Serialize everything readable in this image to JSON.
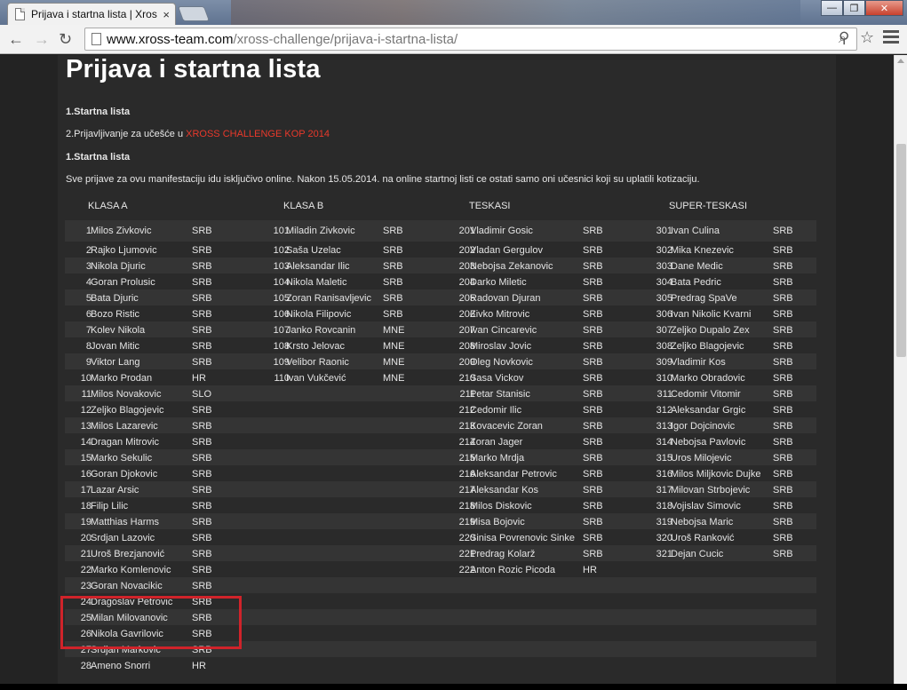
{
  "browser": {
    "tab_title": "Prijava i startna lista | Xros",
    "tab_close": "×",
    "url_host": "www.xross-team.com",
    "url_path": "/xross-challenge/prijava-i-startna-lista/"
  },
  "page": {
    "title": "Prijava i startna lista",
    "link1": "1.Startna lista",
    "link2_prefix": "2.Prijavljivanje za učešće u ",
    "link2_highlight": "XROSS CHALLENGE KOP 2014",
    "section_heading": "1.Startna lista",
    "notice": "Sve prijave za ovu manifestaciju idu isključivo online.   Nakon 15.05.2014. na online startnoj listi ce ostati samo oni učesnici koji su uplatili kotizaciju."
  },
  "columns": [
    "KLASA A",
    "KLASA B",
    "TESKASI",
    "SUPER-TESKASI"
  ],
  "rows": [
    [
      [
        "1",
        "Milos Zivkovic",
        "SRB"
      ],
      [
        "101",
        "Miladin Zivkovic",
        "SRB"
      ],
      [
        "201",
        "Vladimir Gosic",
        "SRB"
      ],
      [
        "301",
        "Ivan Culina",
        "SRB"
      ]
    ],
    [
      [
        "2",
        "Rajko Ljumovic",
        "SRB"
      ],
      [
        "102",
        "Saša Uzelac",
        "SRB"
      ],
      [
        "202",
        "Vladan Gergulov",
        "SRB"
      ],
      [
        "302",
        "Mika Knezevic",
        "SRB"
      ]
    ],
    [
      [
        "3",
        "Nikola Djuric",
        "SRB"
      ],
      [
        "103",
        "Aleksandar Ilic",
        "SRB"
      ],
      [
        "203",
        "Nebojsa Zekanovic",
        "SRB"
      ],
      [
        "303",
        "Dane Medic",
        "SRB"
      ]
    ],
    [
      [
        "4",
        "Goran Prolusic",
        "SRB"
      ],
      [
        "104",
        "Nikola Maletic",
        "SRB"
      ],
      [
        "204",
        "Darko Miletic",
        "SRB"
      ],
      [
        "304",
        "Bata Pedric",
        "SRB"
      ]
    ],
    [
      [
        "5",
        "Bata Djuric",
        "SRB"
      ],
      [
        "105",
        "Zoran Ranisavljevic",
        "SRB"
      ],
      [
        "205",
        "Radovan Djuran",
        "SRB"
      ],
      [
        "305",
        "Predrag SpaVe",
        "SRB"
      ]
    ],
    [
      [
        "6",
        "Bozo Ristic",
        "SRB"
      ],
      [
        "106",
        "Nikola Filipovic",
        "SRB"
      ],
      [
        "206",
        "Zivko Mitrovic",
        "SRB"
      ],
      [
        "306",
        "Ivan Nikolic Kvarni",
        "SRB"
      ]
    ],
    [
      [
        "7",
        "Kolev Nikola",
        "SRB"
      ],
      [
        "107",
        "Janko Rovcanin",
        "MNE"
      ],
      [
        "207",
        "Ivan Cincarevic",
        "SRB"
      ],
      [
        "307",
        "Zeljko Dupalo Zex",
        "SRB"
      ]
    ],
    [
      [
        "8",
        "Jovan Mitic",
        "SRB"
      ],
      [
        "108",
        "Krsto Jelovac",
        "MNE"
      ],
      [
        "208",
        "Miroslav Jovic",
        "SRB"
      ],
      [
        "308",
        "Zeljko Blagojevic",
        "SRB"
      ]
    ],
    [
      [
        "9",
        "Viktor Lang",
        "SRB"
      ],
      [
        "109",
        "Velibor Raonic",
        "MNE"
      ],
      [
        "209",
        "Oleg Novkovic",
        "SRB"
      ],
      [
        "309",
        "Vladimir Kos",
        "SRB"
      ]
    ],
    [
      [
        "10",
        "Marko Prodan",
        "HR"
      ],
      [
        "110",
        "Ivan Vukčević",
        "MNE"
      ],
      [
        "210",
        "Sasa Vickov",
        "SRB"
      ],
      [
        "310",
        "Marko Obradovic",
        "SRB"
      ]
    ],
    [
      [
        "11",
        "Milos Novakovic",
        "SLO"
      ],
      null,
      [
        "211",
        "Petar Stanisic",
        "SRB"
      ],
      [
        "311",
        "Cedomir Vitomir",
        "SRB"
      ]
    ],
    [
      [
        "12",
        "Zeljko Blagojevic",
        "SRB"
      ],
      null,
      [
        "212",
        "Cedomir Ilic",
        "SRB"
      ],
      [
        "312",
        "Aleksandar Grgic",
        "SRB"
      ]
    ],
    [
      [
        "13",
        "Milos Lazarevic",
        "SRB"
      ],
      null,
      [
        "213",
        "Kovacevic Zoran",
        "SRB"
      ],
      [
        "313",
        "Igor Dojcinovic",
        "SRB"
      ]
    ],
    [
      [
        "14",
        "Dragan Mitrovic",
        "SRB"
      ],
      null,
      [
        "214",
        "Zoran Jager",
        "SRB"
      ],
      [
        "314",
        "Nebojsa Pavlovic",
        "SRB"
      ]
    ],
    [
      [
        "15",
        "Marko Sekulic",
        "SRB"
      ],
      null,
      [
        "215",
        "Marko Mrdja",
        "SRB"
      ],
      [
        "315",
        "Uros Milojevic",
        "SRB"
      ]
    ],
    [
      [
        "16",
        "Goran Djokovic",
        "SRB"
      ],
      null,
      [
        "216",
        "Aleksandar Petrovic",
        "SRB"
      ],
      [
        "316",
        "Milos Miljkovic Dujke",
        "SRB"
      ]
    ],
    [
      [
        "17",
        "Lazar Arsic",
        "SRB"
      ],
      null,
      [
        "217",
        "Aleksandar Kos",
        "SRB"
      ],
      [
        "317",
        "Milovan Strbojevic",
        "SRB"
      ]
    ],
    [
      [
        "18",
        "Filip Lilic",
        "SRB"
      ],
      null,
      [
        "218",
        "Milos Diskovic",
        "SRB"
      ],
      [
        "318",
        "Vojislav Simovic",
        "SRB"
      ]
    ],
    [
      [
        "19",
        "Matthias Harms",
        "SRB"
      ],
      null,
      [
        "219",
        "Misa Bojovic",
        "SRB"
      ],
      [
        "319",
        "Nebojsa Maric",
        "SRB"
      ]
    ],
    [
      [
        "20",
        "Srdjan Lazovic",
        "SRB"
      ],
      null,
      [
        "220",
        "Sinisa Povrenovic Sinke",
        "SRB"
      ],
      [
        "320",
        "Uroš Ranković",
        "SRB"
      ]
    ],
    [
      [
        "21",
        "Uroš Brezjanović",
        "SRB"
      ],
      null,
      [
        "221",
        "Predrag Kolarž",
        "SRB"
      ],
      [
        "321",
        "Dejan Cucic",
        "SRB"
      ]
    ],
    [
      [
        "22",
        "Marko Komlenovic",
        "SRB"
      ],
      null,
      [
        "222",
        "Anton Rozic Picoda",
        "HR"
      ],
      null
    ],
    [
      [
        "23",
        "Goran Novacikic",
        "SRB"
      ],
      null,
      null,
      null
    ],
    [
      [
        "24",
        "Dragoslav Petrovic",
        "SRB"
      ],
      null,
      null,
      null
    ],
    [
      [
        "25",
        "Milan Milovanovic",
        "SRB"
      ],
      null,
      null,
      null
    ],
    [
      [
        "26",
        "Nikola Gavrilovic",
        "SRB"
      ],
      null,
      null,
      null
    ],
    [
      [
        "27",
        "Srdjan Markovic",
        "SRB"
      ],
      null,
      null,
      null
    ],
    [
      [
        "28",
        "Ameno Snorri",
        "HR"
      ],
      null,
      null,
      null
    ]
  ]
}
